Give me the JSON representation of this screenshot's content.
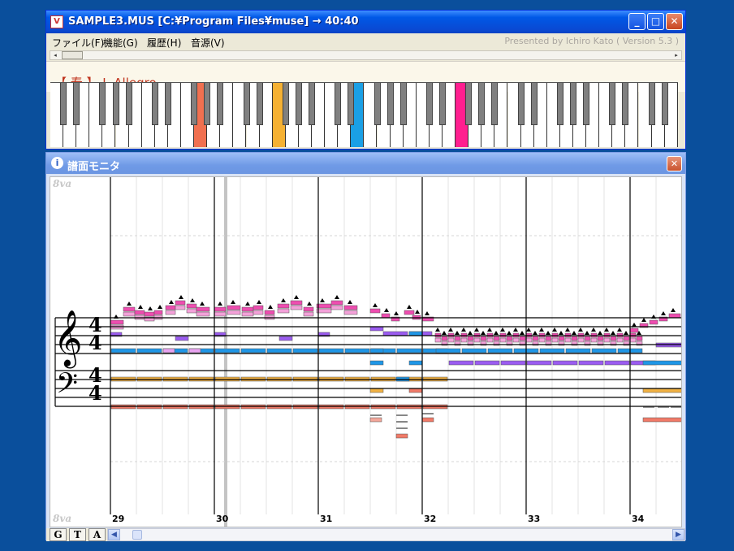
{
  "main_window": {
    "title": "SAMPLE3.MUS [C:¥Program Files¥muse] → 40:40",
    "buttons": {
      "minimize": "_",
      "maximize": "□",
      "close": "✕"
    },
    "menu": [
      "ファイル(F)",
      "機能(G)",
      "履歴(H)",
      "音源(V)"
    ],
    "credit": "Presented by Ichiro Kato ( Version 5.3 )",
    "song_title": "【 春 】 Ⅰ. Allegro"
  },
  "keyboard": {
    "white_key_count": 48,
    "pressed": [
      {
        "type": "white",
        "index": 11,
        "color": "#f07050"
      },
      {
        "type": "white",
        "index": 17,
        "color": "#f5b133"
      },
      {
        "type": "white",
        "index": 23,
        "color": "#1aa0e6"
      },
      {
        "type": "black",
        "index": 30,
        "color": "#ff66cc"
      },
      {
        "type": "white",
        "index": 31,
        "color": "#ff1f8f"
      }
    ]
  },
  "monitor_window": {
    "title": "譜面モニタ",
    "ottava_label": "8va",
    "measure_numbers": [
      "29",
      "30",
      "31",
      "32",
      "33",
      "34"
    ],
    "time_signature": {
      "treble": [
        "4",
        "4"
      ],
      "bass": [
        "4",
        "4"
      ]
    },
    "tabs": [
      "G",
      "T",
      "A"
    ],
    "colors": {
      "violin1": "#ee4db0",
      "violin2": "#9b5cf0",
      "viola": "#1f96e6",
      "cello": "#f1b244",
      "bass": "#f07a68",
      "highlight": "#e8a3f0"
    }
  }
}
